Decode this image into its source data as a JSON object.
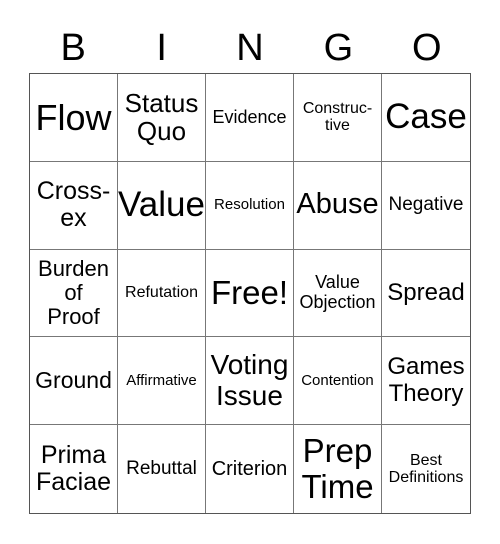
{
  "header": {
    "letters": [
      "B",
      "I",
      "N",
      "G",
      "O"
    ]
  },
  "cells": [
    {
      "text": "Flow",
      "size": 36
    },
    {
      "text": "Status\nQuo",
      "size": 26
    },
    {
      "text": "Evidence",
      "size": 18
    },
    {
      "text": "Construc-\ntive",
      "size": 16
    },
    {
      "text": "Case",
      "size": 35
    },
    {
      "text": "Cross-\nex",
      "size": 25
    },
    {
      "text": "Value",
      "size": 35
    },
    {
      "text": "Resolution",
      "size": 15
    },
    {
      "text": "Abuse",
      "size": 29
    },
    {
      "text": "Negative",
      "size": 19
    },
    {
      "text": "Burden\nof\nProof",
      "size": 22
    },
    {
      "text": "Refutation",
      "size": 16
    },
    {
      "text": "Free!",
      "size": 33
    },
    {
      "text": "Value\nObjection",
      "size": 18
    },
    {
      "text": "Spread",
      "size": 24
    },
    {
      "text": "Ground",
      "size": 23
    },
    {
      "text": "Affirmative",
      "size": 15
    },
    {
      "text": "Voting\nIssue",
      "size": 28
    },
    {
      "text": "Contention",
      "size": 15
    },
    {
      "text": "Games\nTheory",
      "size": 24
    },
    {
      "text": "Prima\nFaciae",
      "size": 25
    },
    {
      "text": "Rebuttal",
      "size": 19
    },
    {
      "text": "Criterion",
      "size": 20
    },
    {
      "text": "Prep\nTime",
      "size": 33
    },
    {
      "text": "Best\nDefinitions",
      "size": 16
    }
  ]
}
